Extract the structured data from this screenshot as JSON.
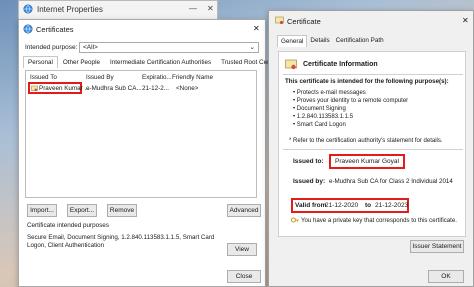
{
  "internet_props": {
    "title": "Internet Properties",
    "minimize": "—",
    "close": "✕"
  },
  "certs": {
    "title": "Certificates",
    "close": "✕",
    "intended_label": "Intended purpose:",
    "intended_value": "<All>",
    "tabs": [
      "Personal",
      "Other People",
      "Intermediate Certification Authorities",
      "Trusted Root Certification"
    ],
    "columns": [
      "Issued To",
      "Issued By",
      "Expiratio...",
      "Friendly Name"
    ],
    "row": {
      "issued_to": "Praveen Kumar ...",
      "issued_by": "e-Mudhra Sub CA...",
      "expiration": "21-12-2...",
      "friendly": "<None>"
    },
    "buttons": {
      "import": "Import...",
      "export": "Export...",
      "remove": "Remove",
      "advanced": "Advanced",
      "view": "View",
      "close": "Close"
    },
    "purposes_title": "Certificate intended purposes",
    "purposes_text": "Secure Email, Document Signing, 1.2.840.113583.1.1.5, Smart Card Logon, Client Authentication"
  },
  "cert": {
    "title": "Certificate",
    "close": "✕",
    "tabs": [
      "General",
      "Details",
      "Certification Path"
    ],
    "info_title": "Certificate Information",
    "intended_heading": "This certificate is intended for the following purpose(s):",
    "purposes": [
      "Protects e-mail messages",
      "Proves your identity to a remote computer",
      "Document Signing",
      "1.2.840.113583.1.1.5",
      "Smart Card Logon"
    ],
    "note": "* Refer to the certification authority's statement for details.",
    "issued_to_label": "Issued to:",
    "issued_to": "Praveen Kumar Goyal",
    "issued_by_label": "Issued by:",
    "issued_by": "e-Mudhra Sub CA for Class 2 Individual 2014",
    "valid_from_label": "Valid from",
    "valid_from": "21-12-2020",
    "to_label": "to",
    "valid_to": "21-12-2023",
    "private_key": "You have a private key that corresponds to this certificate.",
    "issuer_statement": "Issuer Statement",
    "ok": "OK"
  },
  "colors": {
    "highlight": "#e21b1b",
    "accent": "#0067c0"
  }
}
